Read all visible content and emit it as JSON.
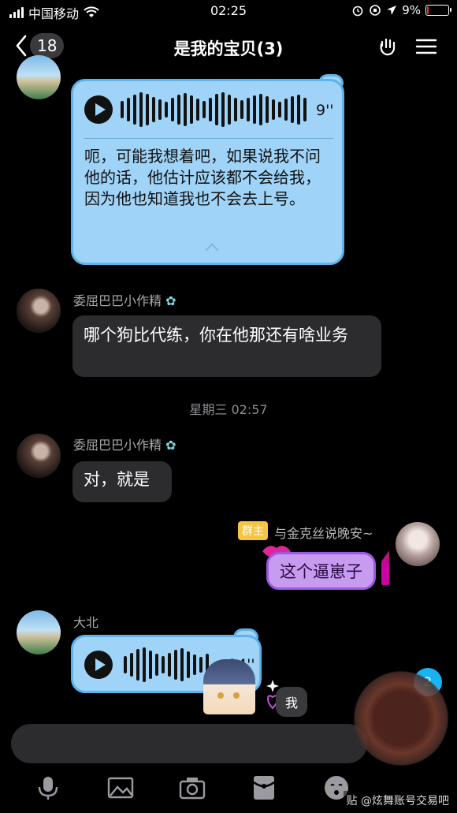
{
  "status_bar": {
    "carrier": "中国移动",
    "time": "02:25",
    "battery": "9%",
    "battery_level": 0.09
  },
  "nav": {
    "back_count": "18",
    "title": "是我的宝贝(3)"
  },
  "messages": {
    "voice1": {
      "duration": "9''",
      "transcript": "呃，可能我想着吧，如果说我不问他的话，他估计应该都不会给我，因为他也知道我也不会去上号。"
    },
    "msg2": {
      "sender": "委屈巴巴小作精",
      "text": "哪个狗比代练，你在他那还有啥业务"
    },
    "timestamp": "星期三 02:57",
    "msg3": {
      "sender": "委屈巴巴小作精",
      "text": "对，就是"
    },
    "msg4": {
      "badge": "群主",
      "sender": "与金克丝说晚安~",
      "text": "这个逼崽子"
    },
    "voice5": {
      "sender": "大北",
      "duration": "14''"
    },
    "me_chip": "我"
  },
  "unread_count": "2",
  "watermark": "贴 @炫舞账号交易吧",
  "colors": {
    "voice_bubble": "#9fd3f7",
    "voice_border": "#5fb2ea",
    "purple_bubble": "#c79cf0",
    "owner_badge": "#f5c544",
    "unread": "#18b3f0"
  }
}
